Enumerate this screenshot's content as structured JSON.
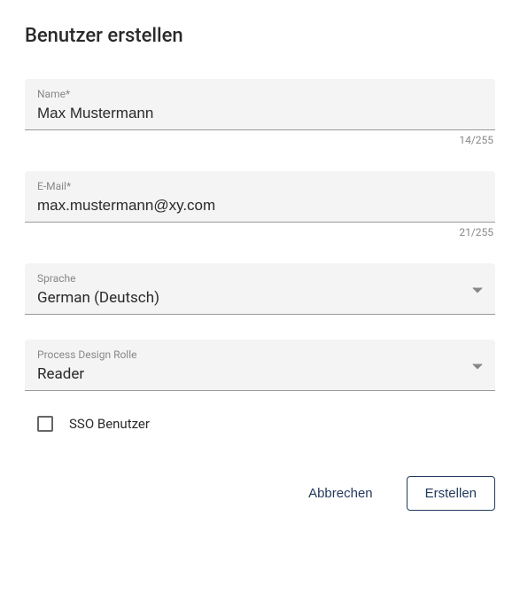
{
  "title": "Benutzer erstellen",
  "fields": {
    "name": {
      "label": "Name*",
      "value": "Max Mustermann",
      "counter": "14/255"
    },
    "email": {
      "label": "E-Mail*",
      "value": "max.mustermann@xy.com",
      "counter": "21/255"
    },
    "language": {
      "label": "Sprache",
      "value": "German (Deutsch)"
    },
    "role": {
      "label": "Process Design Rolle",
      "value": "Reader"
    }
  },
  "checkbox": {
    "label": "SSO Benutzer",
    "checked": false
  },
  "buttons": {
    "cancel": "Abbrechen",
    "create": "Erstellen"
  }
}
